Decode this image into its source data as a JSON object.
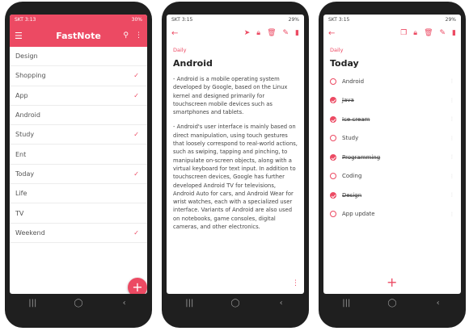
{
  "colors": {
    "accent": "#ec4a63",
    "bezel": "#1f1f1f"
  },
  "status": {
    "carrier": "SKT",
    "time1": "3:13",
    "time2": "3:15",
    "battery1": "30%",
    "battery2": "29%"
  },
  "navbar": {
    "recents": "|||",
    "home": "◯",
    "back": "‹"
  },
  "list_screen": {
    "title": "FastNote",
    "items": [
      {
        "label": "Design",
        "checked": false
      },
      {
        "label": "Shopping",
        "checked": true
      },
      {
        "label": "App",
        "checked": true
      },
      {
        "label": "Android",
        "checked": false
      },
      {
        "label": "Study",
        "checked": true
      },
      {
        "label": "Ent",
        "checked": false
      },
      {
        "label": "Today",
        "checked": true
      },
      {
        "label": "Life",
        "checked": false
      },
      {
        "label": "TV",
        "checked": false
      },
      {
        "label": "Weekend",
        "checked": true
      }
    ],
    "fab": "+"
  },
  "note_screen": {
    "category": "Daily",
    "title": "Android",
    "paragraphs": [
      "- Android is a mobile operating system developed by Google, based on the Linux kernel and designed primarily for touchscreen mobile devices such as smartphones and tablets.",
      "- Android's user interface is mainly based on direct manipulation, using touch gestures that loosely correspond to real-world actions, such as swiping, tapping and pinching, to manipulate on-screen objects, along with a virtual keyboard for text input. In addition to touchscreen devices, Google has further developed Android TV for televisions, Android Auto for cars, and Android Wear for wrist watches, each with a specialized user interface. Variants of Android are also used on notebooks, game consoles, digital cameras, and other electronics."
    ]
  },
  "checklist_screen": {
    "category": "Daily",
    "title": "Today",
    "items": [
      {
        "label": "Android",
        "checked": false
      },
      {
        "label": "Java",
        "checked": true
      },
      {
        "label": "Ice cream",
        "checked": true
      },
      {
        "label": "Study",
        "checked": false
      },
      {
        "label": "Programming",
        "checked": true
      },
      {
        "label": "Coding",
        "checked": false
      },
      {
        "label": "Design",
        "checked": true
      },
      {
        "label": "App update",
        "checked": false
      }
    ],
    "add": "+"
  }
}
